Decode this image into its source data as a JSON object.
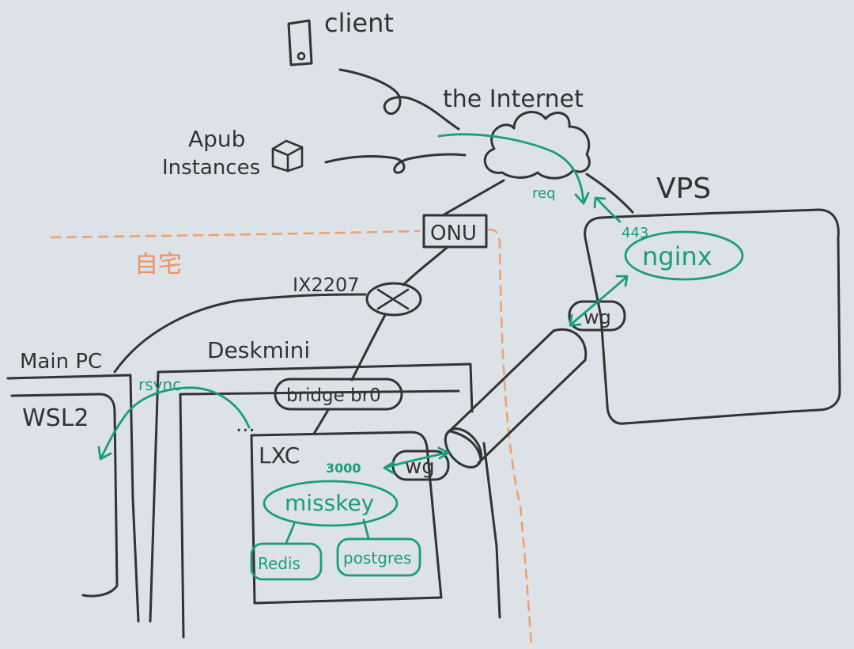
{
  "diagram": {
    "labels": {
      "client": "client",
      "internet": "the Internet",
      "apub_line1": "Apub",
      "apub_line2": "Instances",
      "vps": "VPS",
      "onu": "ONU",
      "home": "自宅",
      "ix2207": "IX2207",
      "main_pc": "Main PC",
      "deskmini": "Deskmini",
      "wsl2": "WSL2",
      "bridge": "bridge br0",
      "lxc": "LXC",
      "ellipsis": "...",
      "wg_vps": "wg",
      "wg_lxc": "wg",
      "nginx": "nginx",
      "port_443": "443",
      "port_3000": "3000",
      "req": "req",
      "rsync": "rsync",
      "misskey": "misskey",
      "redis": "Redis",
      "postgres": "postgres"
    },
    "colors": {
      "background": "#dce2e8",
      "ink": "#333333",
      "accent_green": "#1a9e78",
      "home_boundary": "#f0a070"
    },
    "icons": {
      "client": "phone-icon",
      "apub": "cube-icon",
      "internet": "cloud-icon",
      "router": "router-icon",
      "tunnel": "wireguard-tunnel"
    }
  }
}
